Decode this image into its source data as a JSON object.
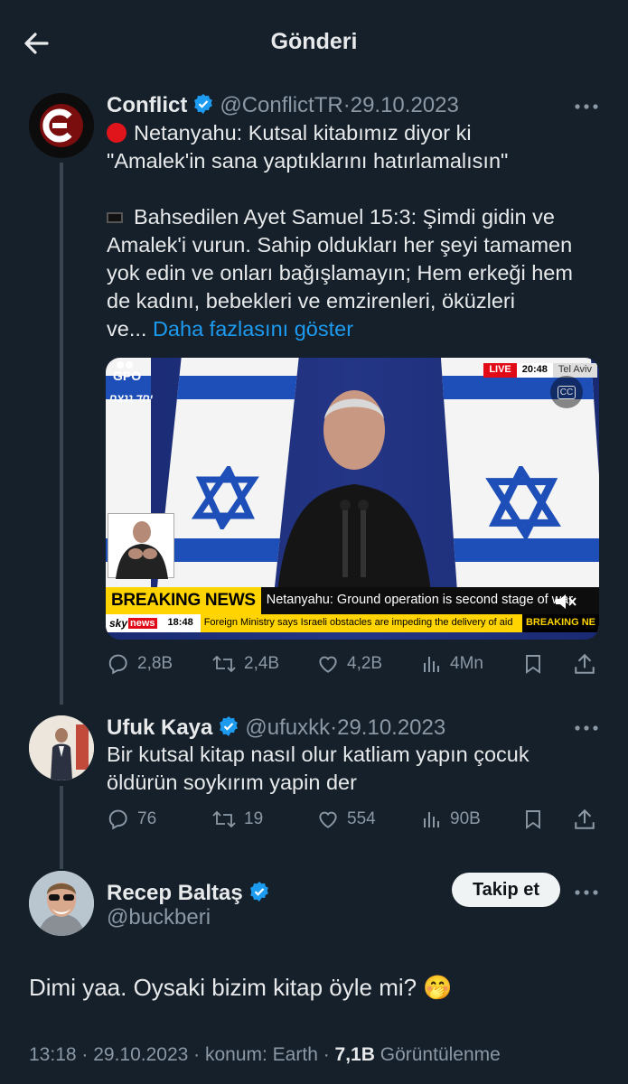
{
  "header": {
    "title": "Gönderi"
  },
  "tweet1": {
    "name": "Conflict",
    "handle": "@ConflictTR",
    "date": "29.10.2023",
    "line1": "Netanyahu: Kutsal kitabımız diyor ki",
    "line2": "\"Amalek'in sana yaptıklarını hatırlamalısın\"",
    "line3": "Bahsedilen Ayet Samuel 15:3: Şimdi gidin ve",
    "line4": "Amalek'i vurun. Sahip oldukları her şeyi tamamen",
    "line5": "yok edin ve onları bağışlamayın; Hem erkeği hem",
    "line6": "de kadını, bebekleri ve emzirenleri, öküzleri",
    "line7": "ve...",
    "show_more": "Daha fazlasını göster",
    "replies": "2,8B",
    "retweets": "2,4B",
    "likes": "4,2B",
    "views": "4Mn",
    "media": {
      "gpo": "GPO",
      "hebrew": "יחד ננצח",
      "live": "LIVE",
      "time": "20:48",
      "city": "Tel Aviv",
      "cc": "CC",
      "breaking": "BREAKING NEWS",
      "headline": "Netanyahu: Ground operation is second stage of war",
      "brand_sky": "sky",
      "brand_news": "news",
      "ticker_time": "18:48",
      "ticker": "Foreign Ministry says Israeli obstacles are impeding the delivery of aid",
      "breaking_small": "BREAKING NE"
    }
  },
  "tweet2": {
    "name": "Ufuk Kaya",
    "handle": "@ufuxkk",
    "date": "29.10.2023",
    "line1": "Bir kutsal kitap nasıl olur katliam yapın çocuk",
    "line2": "öldürün soykırım yapin der",
    "replies": "76",
    "retweets": "19",
    "likes": "554",
    "views": "90B"
  },
  "main": {
    "name": "Recep Baltaş",
    "handle": "@buckberi",
    "follow": "Takip et",
    "text": "Dimi yaa. Oysaki bizim kitap öyle mi? 🤭",
    "meta_time": "13:18 · 29.10.2023 · konum: Earth · ",
    "meta_views": "7,1B",
    "meta_views_label": " Görüntülenme"
  },
  "colors": {
    "bg": "#15202b",
    "accent": "#1d9bf0",
    "muted": "#8b98a5"
  }
}
